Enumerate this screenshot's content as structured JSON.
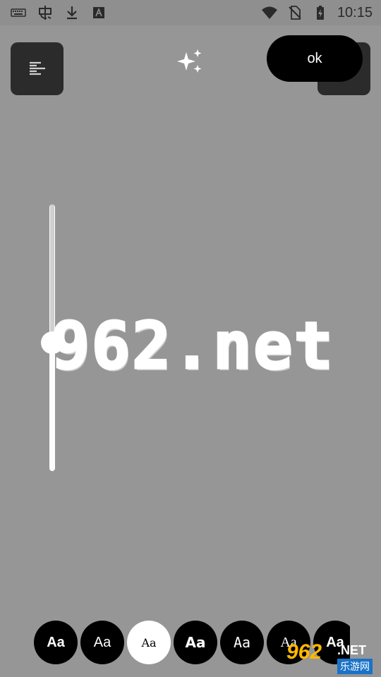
{
  "status_bar": {
    "time": "10:15",
    "icons": [
      "keyboard-icon",
      "app-bug-icon",
      "download-icon",
      "text-app-icon",
      "wifi-icon",
      "no-sim-icon",
      "battery-icon"
    ]
  },
  "toolbar": {
    "align_icon": "align-left-icon",
    "effects_icon": "sparkle-icon",
    "ok_label": "ok"
  },
  "editor": {
    "text": "962.net",
    "text_color": "#ffffff",
    "size_slider_value": 0.5
  },
  "font_picker": {
    "selected_index": 2,
    "fonts": [
      {
        "label": "Aa"
      },
      {
        "label": "Aa"
      },
      {
        "label": "Aa"
      },
      {
        "label": "Aa"
      },
      {
        "label": "Aa"
      },
      {
        "label": "Aa"
      },
      {
        "label": "Aa"
      }
    ]
  },
  "watermark": {
    "number": "962",
    "domain": ".NET",
    "chinese": "乐游网"
  },
  "colors": {
    "background": "#969696",
    "button_dark": "#2b2b2b",
    "ok_button": "#000000",
    "watermark_orange": "#ffb800",
    "watermark_blue": "#1a73c8"
  }
}
